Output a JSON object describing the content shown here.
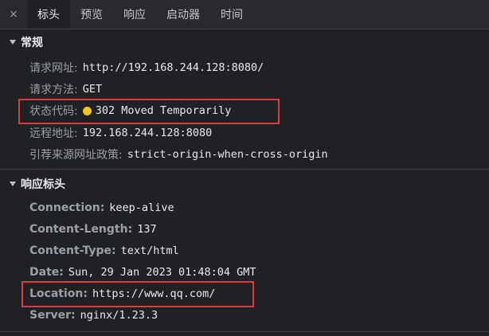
{
  "tabs": {
    "close_icon": "×",
    "items": [
      {
        "label": "标头",
        "active": true
      },
      {
        "label": "预览"
      },
      {
        "label": "响应"
      },
      {
        "label": "启动器"
      },
      {
        "label": "时间"
      }
    ]
  },
  "general": {
    "title": "常规",
    "request_url": {
      "key": "请求网址:",
      "value": "http://192.168.244.128:8080/"
    },
    "request_method": {
      "key": "请求方法:",
      "value": "GET"
    },
    "status_code": {
      "key": "状态代码:",
      "value": "302 Moved Temporarily",
      "dot_color": "#f5c518"
    },
    "remote_address": {
      "key": "远程地址:",
      "value": "192.168.244.128:8080"
    },
    "referrer_policy": {
      "key": "引荐来源网址政策:",
      "value": "strict-origin-when-cross-origin"
    }
  },
  "response_headers": {
    "title": "响应标头",
    "connection": {
      "key": "Connection:",
      "value": "keep-alive"
    },
    "content_length": {
      "key": "Content-Length:",
      "value": "137"
    },
    "content_type": {
      "key": "Content-Type:",
      "value": "text/html"
    },
    "date": {
      "key": "Date:",
      "value": "Sun, 29 Jan 2023 01:48:04 GMT"
    },
    "location": {
      "key": "Location:",
      "value": "https://www.qq.com/"
    },
    "server": {
      "key": "Server:",
      "value": "nginx/1.23.3"
    }
  },
  "highlight_color": "#e0393e"
}
